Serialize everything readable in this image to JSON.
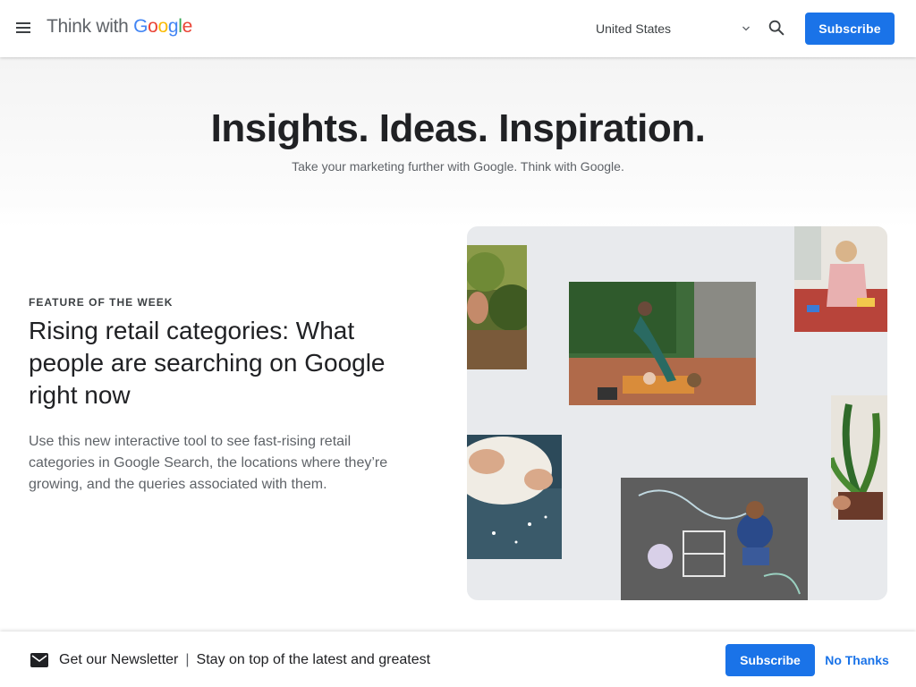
{
  "header": {
    "logo_text": "Think with",
    "logo_google": [
      "G",
      "o",
      "o",
      "g",
      "l",
      "e"
    ],
    "logo_colors": [
      "#4285f4",
      "#ea4335",
      "#fbbc05",
      "#4285f4",
      "#34a853",
      "#ea4335"
    ],
    "country": "United States",
    "subscribe_label": "Subscribe"
  },
  "hero": {
    "title": "Insights. Ideas. Inspiration.",
    "subtitle": "Take your marketing further with Google. Think with Google."
  },
  "feature": {
    "eyebrow": "FEATURE OF THE WEEK",
    "title": "Rising retail categories: What people are searching on Google right now",
    "description": "Use this new interactive tool to see fast-rising retail categories in Google Search, the locations where they’re growing, and the queries associated with them."
  },
  "newsletter": {
    "heading": "Get our Newsletter",
    "separator": "|",
    "tagline": "Stay on top of the latest and greatest",
    "subscribe_label": "Subscribe",
    "dismiss_label": "No Thanks"
  },
  "colors": {
    "accent": "#1a73e8",
    "text": "#202124",
    "muted": "#5f6368",
    "image_bg": "#e8eaed"
  }
}
